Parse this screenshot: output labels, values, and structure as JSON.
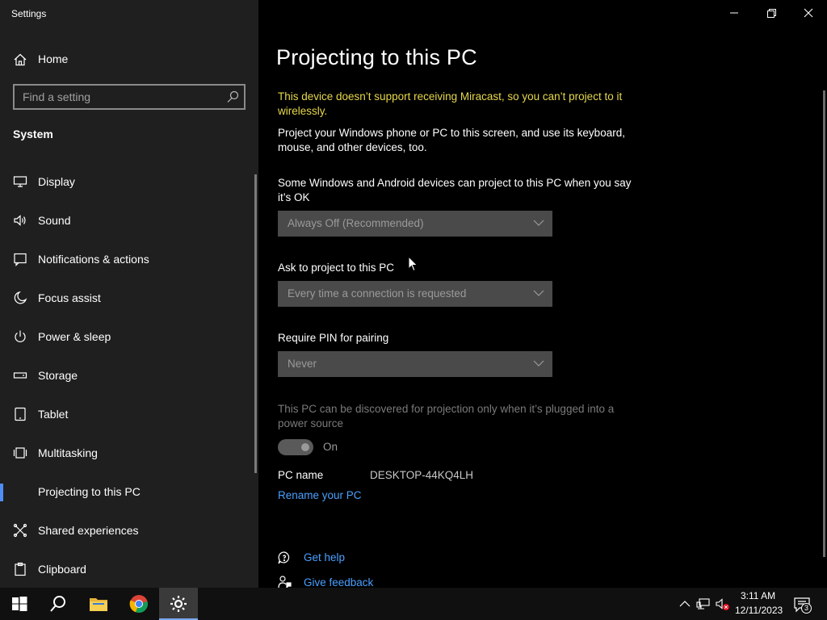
{
  "window": {
    "title": "Settings"
  },
  "sidebar": {
    "home_label": "Home",
    "search_placeholder": "Find a setting",
    "section_label": "System",
    "items": [
      {
        "label": "Display",
        "icon": "monitor-icon"
      },
      {
        "label": "Sound",
        "icon": "speaker-icon"
      },
      {
        "label": "Notifications & actions",
        "icon": "notification-icon"
      },
      {
        "label": "Focus assist",
        "icon": "moon-icon"
      },
      {
        "label": "Power & sleep",
        "icon": "power-icon"
      },
      {
        "label": "Storage",
        "icon": "storage-icon"
      },
      {
        "label": "Tablet",
        "icon": "tablet-icon"
      },
      {
        "label": "Multitasking",
        "icon": "multitasking-icon"
      },
      {
        "label": "Projecting to this PC",
        "icon": "project-icon",
        "active": true
      },
      {
        "label": "Shared experiences",
        "icon": "shared-icon"
      },
      {
        "label": "Clipboard",
        "icon": "clipboard-icon"
      }
    ]
  },
  "main": {
    "title": "Projecting to this PC",
    "warning": "This device doesn’t support receiving Miracast, so you can’t project to it wirelessly.",
    "intro": "Project your Windows phone or PC to this screen, and use its keyboard, mouse, and other devices, too.",
    "availability_label": "Some Windows and Android devices can project to this PC when you say it’s OK",
    "availability_value": "Always Off (Recommended)",
    "ask_label": "Ask to project to this PC",
    "ask_value": "Every time a connection is requested",
    "pin_label": "Require PIN for pairing",
    "pin_value": "Never",
    "power_label": "This PC can be discovered for projection only when it’s plugged into a power source",
    "power_toggle_label": "On",
    "pc_name_label": "PC name",
    "pc_name_value": "DESKTOP-44KQ4LH",
    "rename_link": "Rename your PC",
    "get_help": "Get help",
    "give_feedback": "Give feedback"
  },
  "taskbar": {
    "apps": [
      "start-icon",
      "search-icon",
      "file-explorer-icon",
      "chrome-icon",
      "settings-icon"
    ],
    "active_app": "settings-icon",
    "time": "3:11 AM",
    "date": "12/11/2023",
    "notification_count": "3"
  },
  "colors": {
    "sidebar_bg": "#1f1f1f",
    "main_bg": "#000000",
    "warning": "#e6d74a",
    "link": "#4aa0ff",
    "accent": "#4f8ef7"
  }
}
